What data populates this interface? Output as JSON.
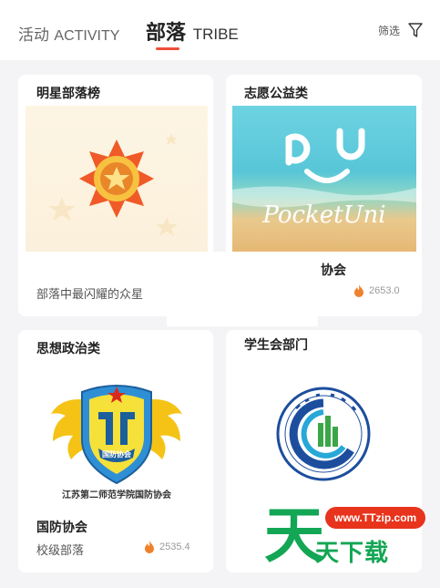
{
  "header": {
    "tab_activity_cn": "活动",
    "tab_activity_en": "ACTIVITY",
    "tab_tribe_cn": "部落",
    "tab_tribe_en": "TRIBE",
    "filter_label": "筛选",
    "filter_icon": "funnel-icon",
    "accent_color": "#ef4f3c"
  },
  "cards": [
    {
      "category": "明星部落榜",
      "subtitle": "部落中最闪耀的众星",
      "image": "star-badge"
    },
    {
      "category": "志愿公益类",
      "image_text": "PocketUni",
      "name_visible": "协会",
      "heat": "2653.0"
    },
    {
      "category": "思想政治类",
      "image_caption": "江苏第二师范学院国防协会",
      "badge_text": "国防协会",
      "name": "国防协会",
      "level": "校级部落",
      "heat": "2535.4"
    },
    {
      "category": "学生会部门",
      "image": "college-seal"
    }
  ],
  "watermark": {
    "url": "www.TTzip.com",
    "big_char": "天",
    "text": "天下载",
    "color": "#13a654"
  }
}
